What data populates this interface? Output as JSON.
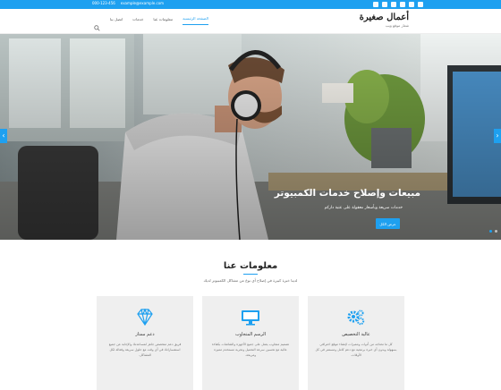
{
  "topbar": {
    "phone": "000-123-456",
    "email": "example@example.com",
    "social": [
      "twitter-icon",
      "facebook-icon",
      "google-icon",
      "pinterest-icon",
      "rss-icon",
      "linkedin-icon"
    ]
  },
  "brand": {
    "title": "أعمال صغيرة",
    "tagline": "شعار موقع ويب"
  },
  "nav": {
    "items": [
      "الصفحة الرئيسية",
      "معلومات عنا",
      "خدمات",
      "اتصل بنا"
    ],
    "active_index": 0
  },
  "hero": {
    "title": "مبيعات وإصلاح خدمات الكمبيوتر",
    "subtitle": "خدمات سريعة وبأسعار معقولة على عتبة داركم",
    "button": "عرض الكل"
  },
  "about": {
    "title": "معلومات عنا",
    "subtitle": "لدينا خبرة كبيرة في إصلاح أي نوع من مشاكل الكمبيوتر لديك",
    "cards": [
      {
        "icon": "gears-icon",
        "title": "عالية التخصيص",
        "desc": "كل ما تحتاجه من أدوات ومميزات لإنشاء موقع احترافي بسهولة وبدون أي خبرة برمجية مع دعم كامل ومستمر في كل الأوقات."
      },
      {
        "icon": "monitor-icon",
        "title": "الرسم المتجاوب",
        "desc": "تصميم متجاوب يعمل على جميع الأجهزة والشاشات بكفاءة عالية مع تحسين سرعة التحميل وتجربة مستخدم مميزة ومريحة."
      },
      {
        "icon": "diamond-icon",
        "title": "دعم ممتاز",
        "desc": "فريق دعم متخصص جاهز لمساعدتك والإجابة عن جميع استفساراتك في أي وقت مع حلول سريعة وفعالة لكل المشاكل."
      }
    ]
  },
  "colors": {
    "accent": "#1ea0f0",
    "card_bg": "#efefef"
  }
}
